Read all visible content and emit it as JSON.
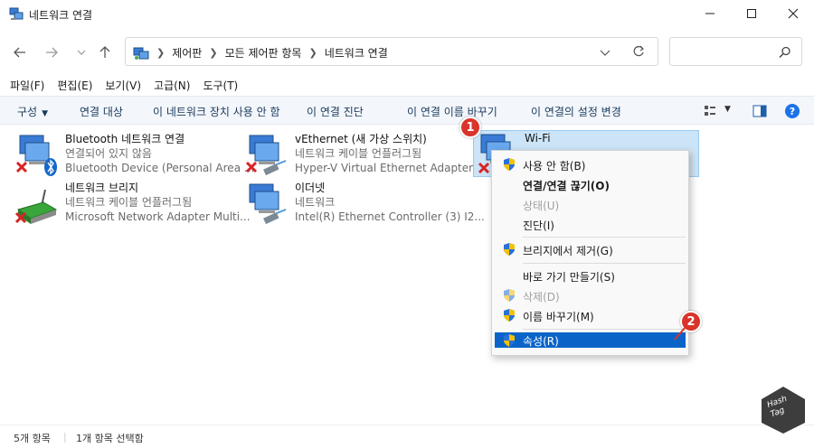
{
  "window": {
    "title": "네트워크 연결"
  },
  "address": {
    "crumbs": [
      "제어판",
      "모든 제어판 항목",
      "네트워크 연결"
    ]
  },
  "menubar": [
    "파일(F)",
    "편집(E)",
    "보기(V)",
    "고급(N)",
    "도구(T)"
  ],
  "commands": {
    "organize": "구성",
    "connect_to": "연결 대상",
    "disable": "이 네트워크 장치 사용 안 함",
    "diagnose": "이 연결 진단",
    "rename": "이 연결 이름 바꾸기",
    "change_settings": "이 연결의 설정 변경"
  },
  "items": [
    {
      "name": "Bluetooth 네트워크 연결",
      "status": "연결되어 있지 않음",
      "device": "Bluetooth Device (Personal Area ..."
    },
    {
      "name": "vEthernet (새 가상 스위치)",
      "status": "네트워크 케이블 언플러그됨",
      "device": "Hyper-V Virtual Ethernet Adapter..."
    },
    {
      "name": "Wi-Fi",
      "status": "",
      "device": ""
    },
    {
      "name": "네트워크 브리지",
      "status": "네트워크 케이블 언플러그됨",
      "device": "Microsoft Network Adapter Multi..."
    },
    {
      "name": "이더넷",
      "status": "네트워크",
      "device": "Intel(R) Ethernet Controller (3) I2..."
    }
  ],
  "context_menu": {
    "disable": "사용 안 함(B)",
    "connect": "연결/연결 끊기(O)",
    "status": "상태(U)",
    "diagnose": "진단(I)",
    "remove_bridge": "브리지에서 제거(G)",
    "shortcut": "바로 가기 만들기(S)",
    "delete": "삭제(D)",
    "rename": "이름 바꾸기(M)",
    "properties": "속성(R)"
  },
  "badges": [
    "1",
    "2"
  ],
  "status": {
    "count": "5개 항목",
    "selected": "1개 항목 선택함"
  },
  "watermark": {
    "line1": "Hash",
    "line2": "Tag"
  },
  "colors": {
    "accent": "#0a64c8",
    "badge": "#d9342b",
    "selection": "#cce4f7"
  }
}
